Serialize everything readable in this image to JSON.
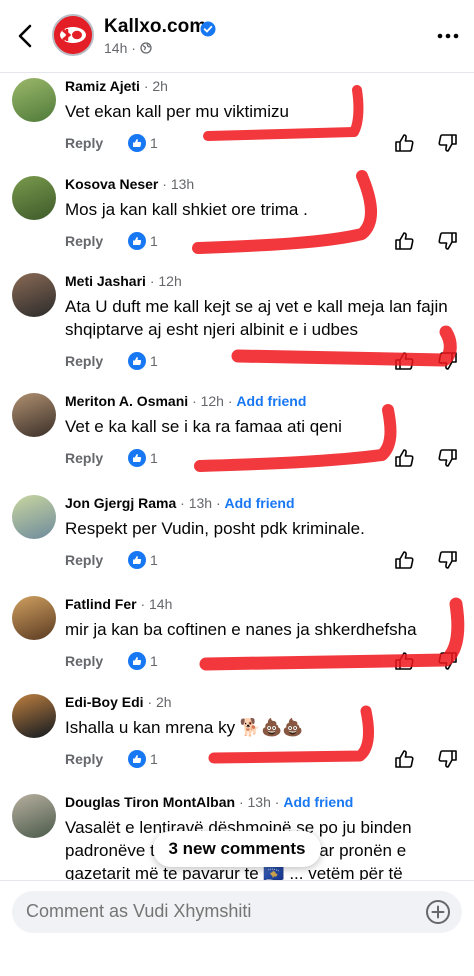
{
  "header": {
    "page_name": "Kallxo.com",
    "time": "14h",
    "back_icon": "back-arrow-icon",
    "more_icon": "more-dots-icon",
    "logo_text": "KO",
    "brand_color": "#e41e26",
    "verified_color": "#1877f2"
  },
  "comments": [
    {
      "name": "Ramiz Ajeti",
      "meta": "· 2h",
      "add_friend": "",
      "text": "Vet ekan kall  per mu viktimizu",
      "reply": "Reply",
      "likes": "1"
    },
    {
      "name": "Kosova Neser",
      "meta": "· 13h",
      "add_friend": "",
      "text": "Mos ja kan kall shkiet ore trima .",
      "reply": "Reply",
      "likes": "1"
    },
    {
      "name": "Meti Jashari",
      "meta": "· 12h",
      "add_friend": "",
      "text": "Ata U duft me kall kejt se aj vet e kall meja lan fajin shqiptarve aj esht njeri albinit e i udbes",
      "reply": "Reply",
      "likes": "1"
    },
    {
      "name": "Meriton A. Osmani",
      "meta": "· 12h ·",
      "add_friend": "Add friend",
      "text": "Vet e ka kall se i ka ra famaa ati qeni",
      "reply": "Reply",
      "likes": "1"
    },
    {
      "name": "Jon Gjergj Rama",
      "meta": "· 13h ·",
      "add_friend": "Add friend",
      "text": "Respekt per Vudin, posht pdk kriminale.",
      "reply": "Reply",
      "likes": "1"
    },
    {
      "name": "Fatlind Fer",
      "meta": "· 14h",
      "add_friend": "",
      "text": "mir ja kan ba coftinen e nanes ja shkerdhefsha",
      "reply": "Reply",
      "likes": "1"
    },
    {
      "name": "Edi-Boy Edi",
      "meta": "· 2h",
      "add_friend": "",
      "text": "Ishalla u kan mrena ky 🐕💩💩",
      "reply": "Reply",
      "likes": "1"
    },
    {
      "name": "Douglas Tiron MontAlban",
      "meta": "· 13h ·",
      "add_friend": "Add friend",
      "text": "Vasalët e lentiravë dëshmojnë se po ju binden padronëve të tyre që kanë uzurpuar pronën e gazetarit më te pavarur te 🇽🇰 ... vetëm për të",
      "reply": "",
      "likes": ""
    }
  ],
  "new_comments_pill": "3 new comments",
  "composer": {
    "placeholder": "Comment as Vudi Xhymshiti",
    "add_icon": "plus-circle-icon"
  },
  "icons": {
    "like": "thumbs-up-icon",
    "dislike": "thumbs-down-icon",
    "reaction": "like-reaction-icon"
  },
  "colors": {
    "link": "#1877f2",
    "secondary_text": "#65676b",
    "annotation": "#f0161c"
  }
}
